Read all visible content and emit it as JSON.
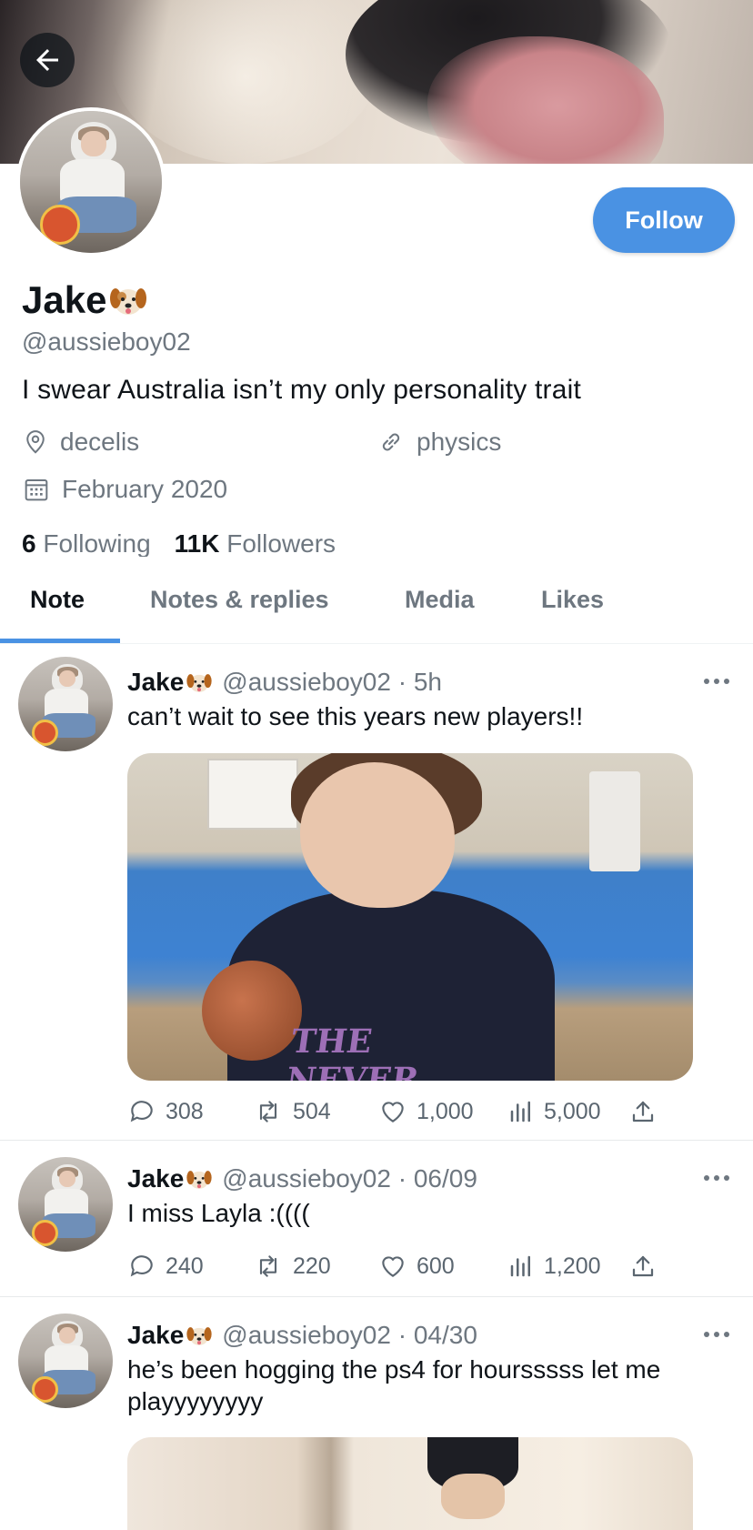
{
  "header": {
    "back_label": "Back"
  },
  "profile": {
    "display_name": "Jake",
    "name_emoji": "dog-face",
    "handle": "@aussieboy02",
    "bio": "I swear Australia isn’t my only personality trait",
    "location": "decelis",
    "website": "physics",
    "joined": "February 2020",
    "following_count": "6",
    "following_label": "Following",
    "followers_count": "11K",
    "followers_label": "Followers",
    "follow_label": "Follow"
  },
  "tabs": [
    {
      "label": "Note",
      "active": true
    },
    {
      "label": "Notes & replies",
      "active": false
    },
    {
      "label": "Media",
      "active": false
    },
    {
      "label": "Likes",
      "active": false
    }
  ],
  "posts": [
    {
      "name": "Jake",
      "meta": "@aussieboy02 · 5h",
      "text": "can’t wait to see this years new players!!",
      "has_image": true,
      "replies": "308",
      "reposts": "504",
      "likes": "1,000",
      "views": "5,000"
    },
    {
      "name": "Jake",
      "meta": "@aussieboy02 · 06/09",
      "text": "I miss Layla :((((",
      "has_image": false,
      "replies": "240",
      "reposts": "220",
      "likes": "600",
      "views": "1,200"
    },
    {
      "name": "Jake",
      "meta": "@aussieboy02 · 04/30",
      "text": "he’s been hogging the ps4 for hoursssss let me playyyyyyyy",
      "has_image": true
    }
  ],
  "colors": {
    "accent": "#4a92e3",
    "muted_text": "#6e7780",
    "primary_text": "#0f1419"
  }
}
